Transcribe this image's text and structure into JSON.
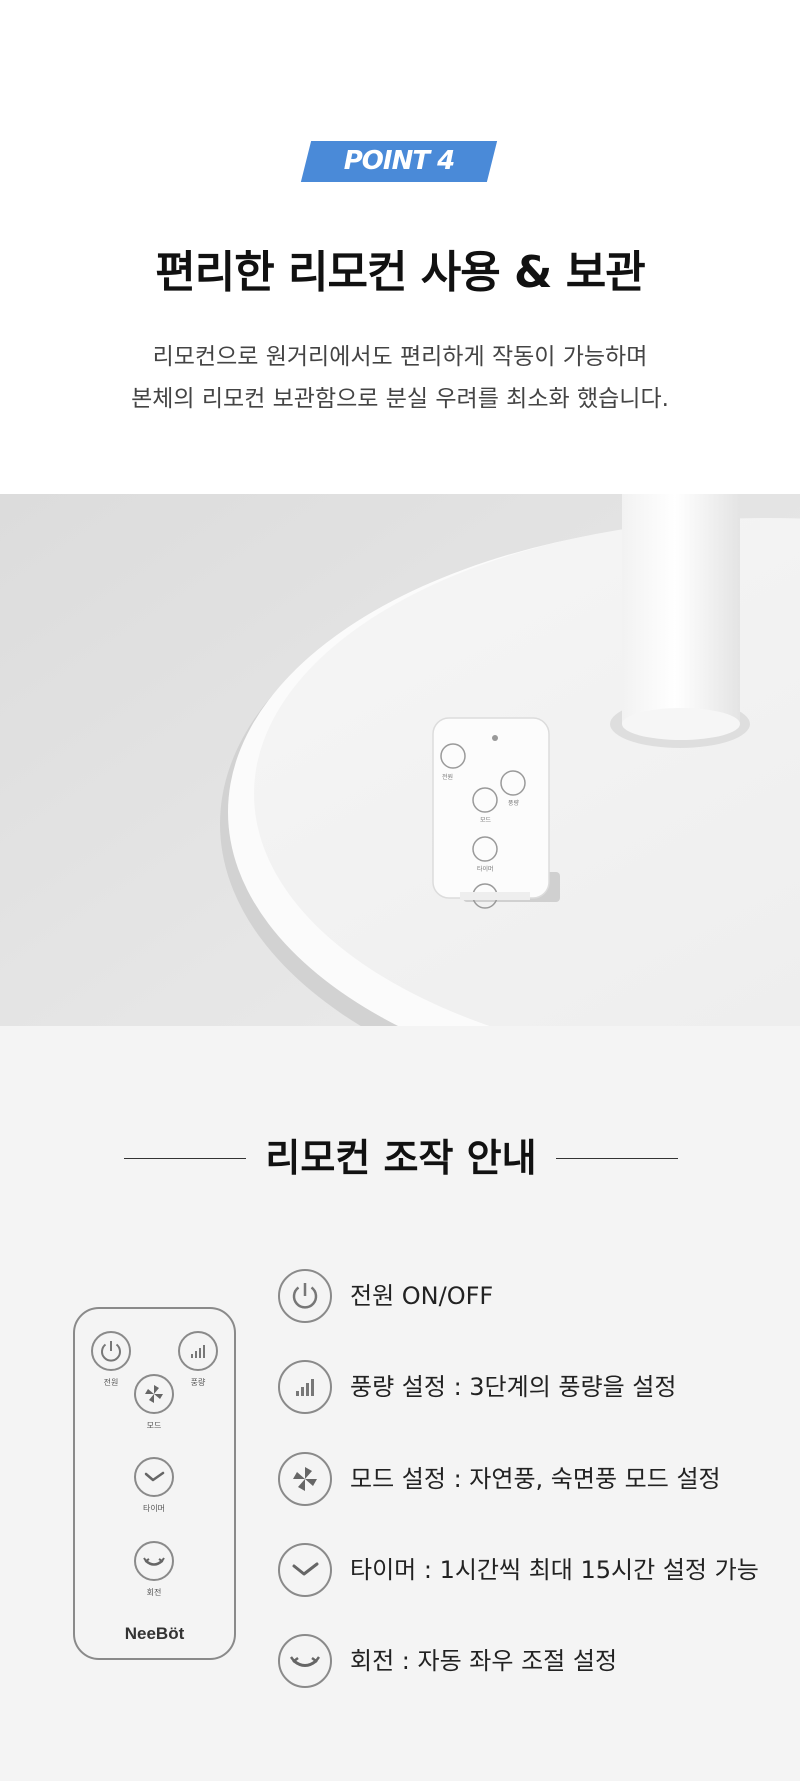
{
  "header": {
    "badge": "POINT 4",
    "title": "편리한 리모컨 사용 & 보관",
    "desc_lines": [
      "리모컨으로 원거리에서도 편리하게 작동이 가능하며",
      "본체의 리모컨 보관함으로 분실 우려를 최소화 했습니다."
    ]
  },
  "photo": {
    "remote_labels": [
      "전원",
      "풍량",
      "모드",
      "타이머"
    ]
  },
  "guide": {
    "title": "리모컨 조작 안내",
    "remote": {
      "buttons": [
        {
          "icon": "power-icon",
          "label": "전원"
        },
        {
          "icon": "wind-level-icon",
          "label": "풍량"
        },
        {
          "icon": "fan-mode-icon",
          "label": "모드"
        },
        {
          "icon": "timer-icon",
          "label": "타이머"
        },
        {
          "icon": "rotate-icon",
          "label": "회전"
        }
      ],
      "brand": "NeeBöt"
    },
    "items": [
      {
        "icon": "power-icon",
        "text": "전원 ON/OFF"
      },
      {
        "icon": "wind-level-icon",
        "text": "풍량 설정 : 3단계의 풍량을 설정"
      },
      {
        "icon": "fan-mode-icon",
        "text": "모드 설정 : 자연풍, 숙면풍 모드 설정"
      },
      {
        "icon": "timer-icon",
        "text": "타이머 : 1시간씩 최대 15시간 설정 가능"
      },
      {
        "icon": "rotate-icon",
        "text": "회전 : 자동 좌우 조절 설정"
      }
    ]
  },
  "colors": {
    "badge": "#4a8ad8",
    "guide_bg": "#f4f4f4",
    "icon_stroke": "#8a8a8a"
  }
}
